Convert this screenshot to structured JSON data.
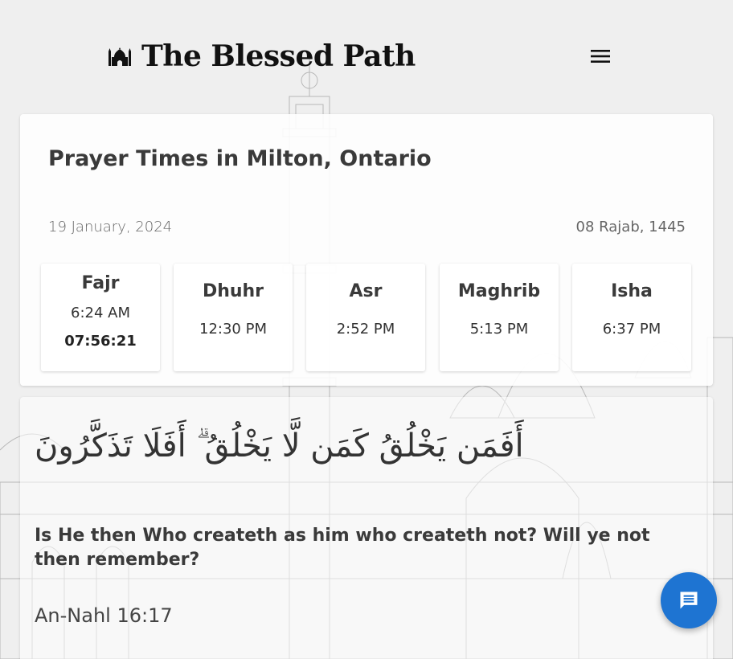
{
  "brand": {
    "name": "The Blessed Path",
    "icon": "mosque-icon"
  },
  "header": {
    "menu_icon": "hamburger-menu-icon"
  },
  "prayer": {
    "title": "Prayer Times in Milton, Ontario",
    "gregorian_date": "19 January, 2024",
    "hijri_date": "08 Rajab, 1445",
    "times": [
      {
        "name": "Fajr",
        "time": "6:24 AM",
        "countdown": "07:56:21"
      },
      {
        "name": "Dhuhr",
        "time": "12:30 PM"
      },
      {
        "name": "Asr",
        "time": "2:52 PM"
      },
      {
        "name": "Maghrib",
        "time": "5:13 PM"
      },
      {
        "name": "Isha",
        "time": "6:37 PM"
      }
    ]
  },
  "verse": {
    "arabic": "أَفَمَن يَخْلُقُ كَمَن لَّا يَخْلُقُ ۗ أَفَلَا تَذَكَّرُونَ",
    "translation": "Is He then Who createth as him who createth not? Will ye not then remember?",
    "reference": "An-Nahl 16:17"
  },
  "chat": {
    "icon": "chat-bubble-icon"
  },
  "colors": {
    "accent": "#1e74d2",
    "background": "#efefef",
    "card": "#ffffff",
    "text": "#333333"
  }
}
